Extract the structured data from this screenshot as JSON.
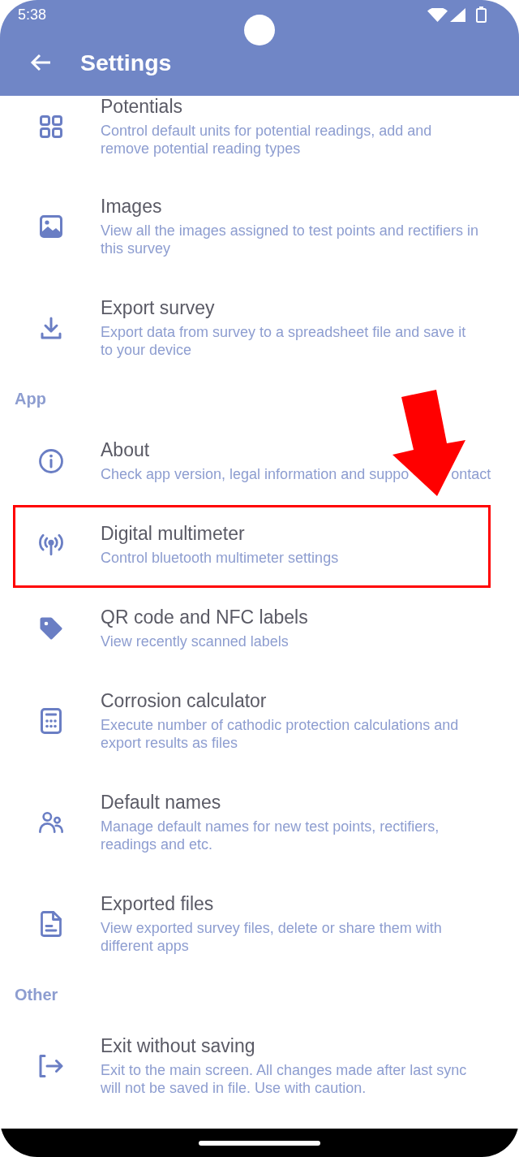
{
  "status_bar": {
    "time": "5:38"
  },
  "app_bar": {
    "title": "Settings"
  },
  "sections": [
    {
      "items": [
        {
          "title": "Potentials",
          "description": "Control default units for potential readings, add and remove potential reading types",
          "highlighted": false
        },
        {
          "title": "Images",
          "description": "View all the images assigned to test points and rectifiers in this survey",
          "highlighted": false
        },
        {
          "title": "Export survey",
          "description": "Export data from survey to a spreadsheet file and save it to your device",
          "highlighted": false
        }
      ]
    },
    {
      "header": "App",
      "items": [
        {
          "title": "About",
          "description_parts": [
            "Check app version, legal information and suppo",
            "ontact"
          ],
          "highlighted": false
        },
        {
          "title": "Digital multimeter",
          "description": "Control bluetooth multimeter settings",
          "highlighted": true
        },
        {
          "title": "QR code and NFC labels",
          "description": "View recently scanned labels",
          "highlighted": false
        },
        {
          "title": "Corrosion calculator",
          "description": "Execute number of cathodic protection calculations and export results as files",
          "highlighted": false
        },
        {
          "title": "Default names",
          "description": "Manage default names for new test points, rectifiers, readings and etc.",
          "highlighted": false
        },
        {
          "title": "Exported files",
          "description": "View exported survey files, delete or share them with different apps",
          "highlighted": false
        }
      ]
    },
    {
      "header": "Other",
      "items": [
        {
          "title": "Exit without saving",
          "description": "Exit to the main screen. All changes made after last sync will not be saved in file. Use with caution.",
          "highlighted": false
        }
      ]
    }
  ]
}
